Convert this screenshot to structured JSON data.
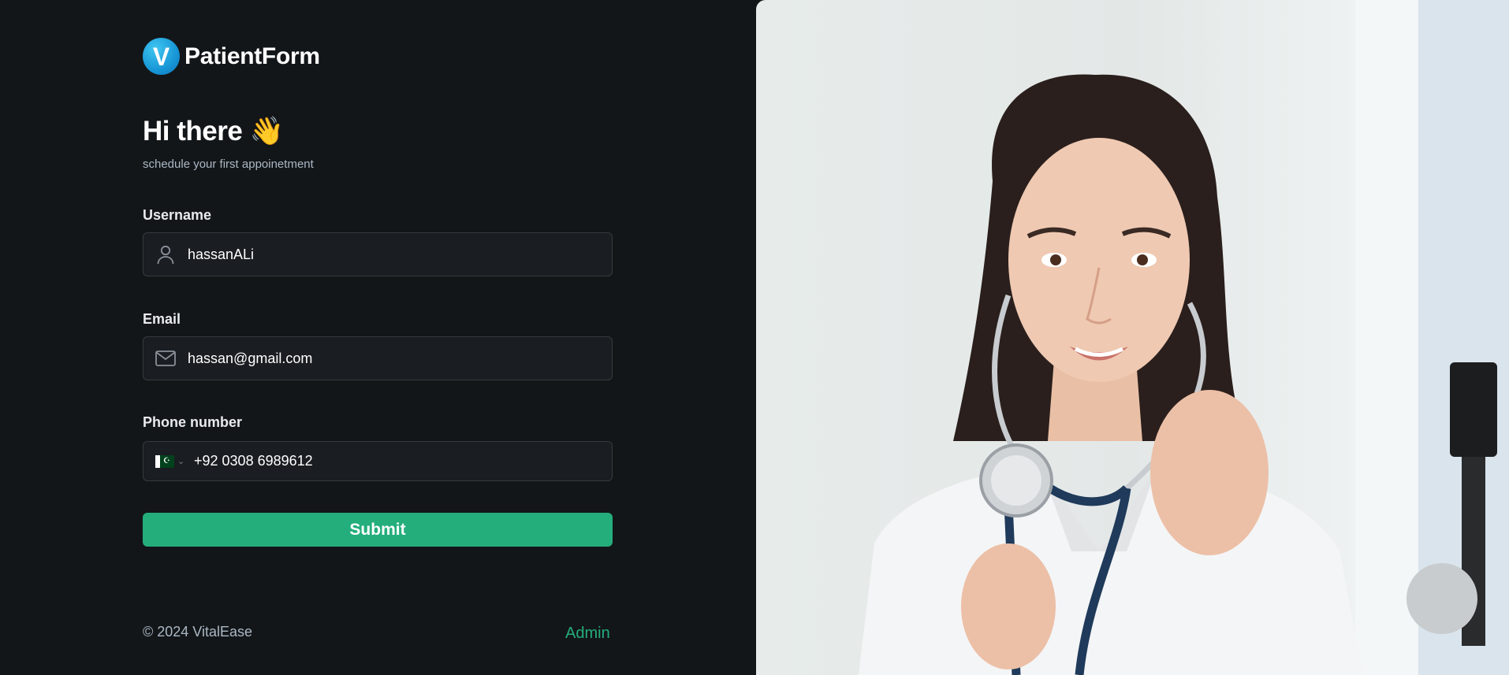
{
  "brand": {
    "name": "PatientForm",
    "logo_letter": "V"
  },
  "header": {
    "greeting": "Hi there",
    "greeting_emoji": "👋",
    "subtitle": "schedule your first appoinetment"
  },
  "form": {
    "username": {
      "label": "Username",
      "value": "hassanALi",
      "icon": "user-icon"
    },
    "email": {
      "label": "Email",
      "value": "hassan@gmail.com",
      "icon": "mail-icon"
    },
    "phone": {
      "label": "Phone number",
      "value": "+92 0308 6989612",
      "country_icon": "pakistan-flag-icon"
    },
    "submit_label": "Submit"
  },
  "footer": {
    "copyright": "© 2024 VitalEase",
    "admin_link": "Admin"
  },
  "colors": {
    "background": "#131619",
    "input_bg": "#1a1d21",
    "input_border": "#363a3d",
    "accent": "#24ae7c",
    "muted_text": "#abb8c4",
    "logo_blue": "#1796d6"
  },
  "hero_image": {
    "subject": "female doctor holding stethoscope, wearing white coat"
  }
}
